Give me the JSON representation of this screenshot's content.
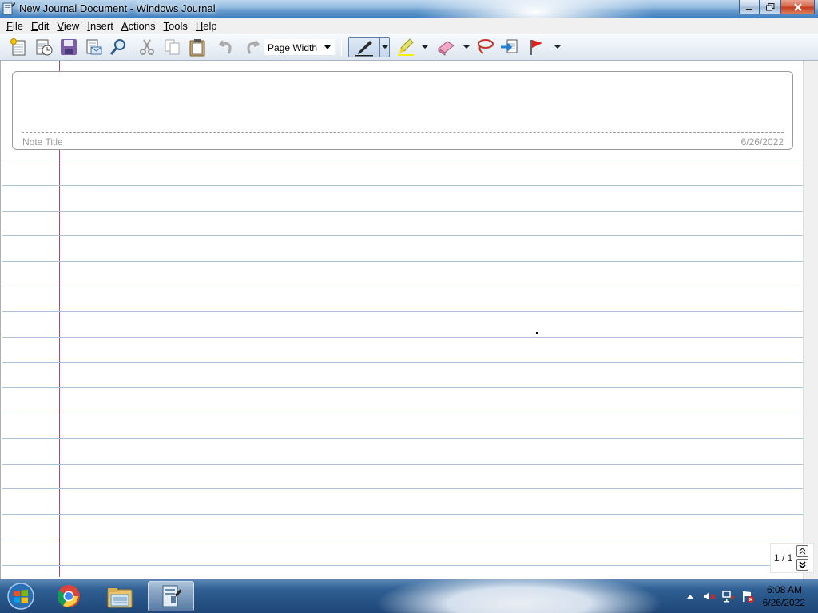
{
  "window": {
    "title": "New Journal Document - Windows Journal",
    "controls": [
      "minimize",
      "restore",
      "close"
    ]
  },
  "menu": [
    {
      "label": "File",
      "key": "F",
      "rest": "ile"
    },
    {
      "label": "Edit",
      "key": "E",
      "rest": "dit"
    },
    {
      "label": "View",
      "key": "V",
      "rest": "iew"
    },
    {
      "label": "Insert",
      "key": "I",
      "rest": "nsert"
    },
    {
      "label": "Actions",
      "key": "A",
      "rest": "ctions"
    },
    {
      "label": "Tools",
      "key": "T",
      "rest": "ools"
    },
    {
      "label": "Help",
      "key": "H",
      "rest": "elp"
    }
  ],
  "toolbar": {
    "zoom_value": "Page Width",
    "buttons": [
      "new-note-icon",
      "open-icon",
      "save-icon",
      "send-email-icon",
      "find-icon",
      "cut-icon",
      "copy-icon",
      "paste-icon",
      "undo-icon",
      "redo-icon",
      "pen-icon",
      "highlighter-icon",
      "eraser-icon",
      "lasso-icon",
      "insert-space-icon",
      "flag-icon"
    ]
  },
  "note": {
    "title_placeholder": "Note Title",
    "date": "6/26/2022"
  },
  "pager": {
    "page_count": "1 / 1"
  },
  "taskbar": {
    "apps": [
      "windows-start",
      "chrome",
      "file-explorer",
      "windows-journal"
    ],
    "active_app": "windows-journal",
    "clock_time": "6:08 AM",
    "clock_date": "6/26/2022"
  },
  "colors": {
    "ruled_line": "#a9c3dc",
    "margin_line": "#b04a6a",
    "title_bar": "#6fa0cf",
    "taskbar": "#1e4677"
  }
}
